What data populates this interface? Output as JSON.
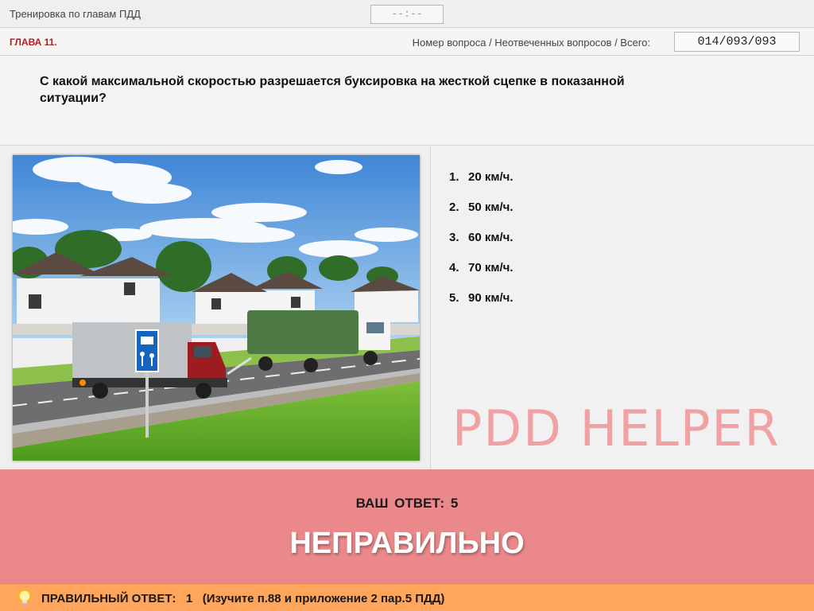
{
  "header": {
    "title": "Тренировка по главам ПДД",
    "timer": "--:--"
  },
  "chapter_bar": {
    "chapter": "ГЛАВА 11.",
    "counter_label": "Номер вопроса / Неотвеченных вопросов / Всего:",
    "counter_value": "014/093/093"
  },
  "question": {
    "text": "С какой максимальной скоростью разрешается буксировка на жесткой сцепке в показанной ситуации?"
  },
  "answers": [
    {
      "number": "1.",
      "label": "20 км/ч."
    },
    {
      "number": "2.",
      "label": "50 км/ч."
    },
    {
      "number": "3.",
      "label": "60 км/ч."
    },
    {
      "number": "4.",
      "label": "70 км/ч."
    },
    {
      "number": "5.",
      "label": "90 км/ч."
    }
  ],
  "watermark": "PDD HELPER",
  "result": {
    "your_answer_label": "ВАШ  ОТВЕТ:",
    "your_answer_value": "5",
    "verdict": "НЕПРАВИЛЬНО"
  },
  "correct": {
    "label": "ПРАВИЛЬНЫЙ ОТВЕТ:",
    "value": "1",
    "hint": "(Изучите п.88 и приложение 2 пар.5 ПДД)"
  },
  "icons": {
    "bulb": "lightbulb-icon",
    "sign": "living-zone-sign-icon"
  },
  "colors": {
    "result_background": "#ea888b",
    "correct_bar": "#ffa65c",
    "chapter_text": "#b71c1c",
    "watermark": "#f1a0a4"
  }
}
